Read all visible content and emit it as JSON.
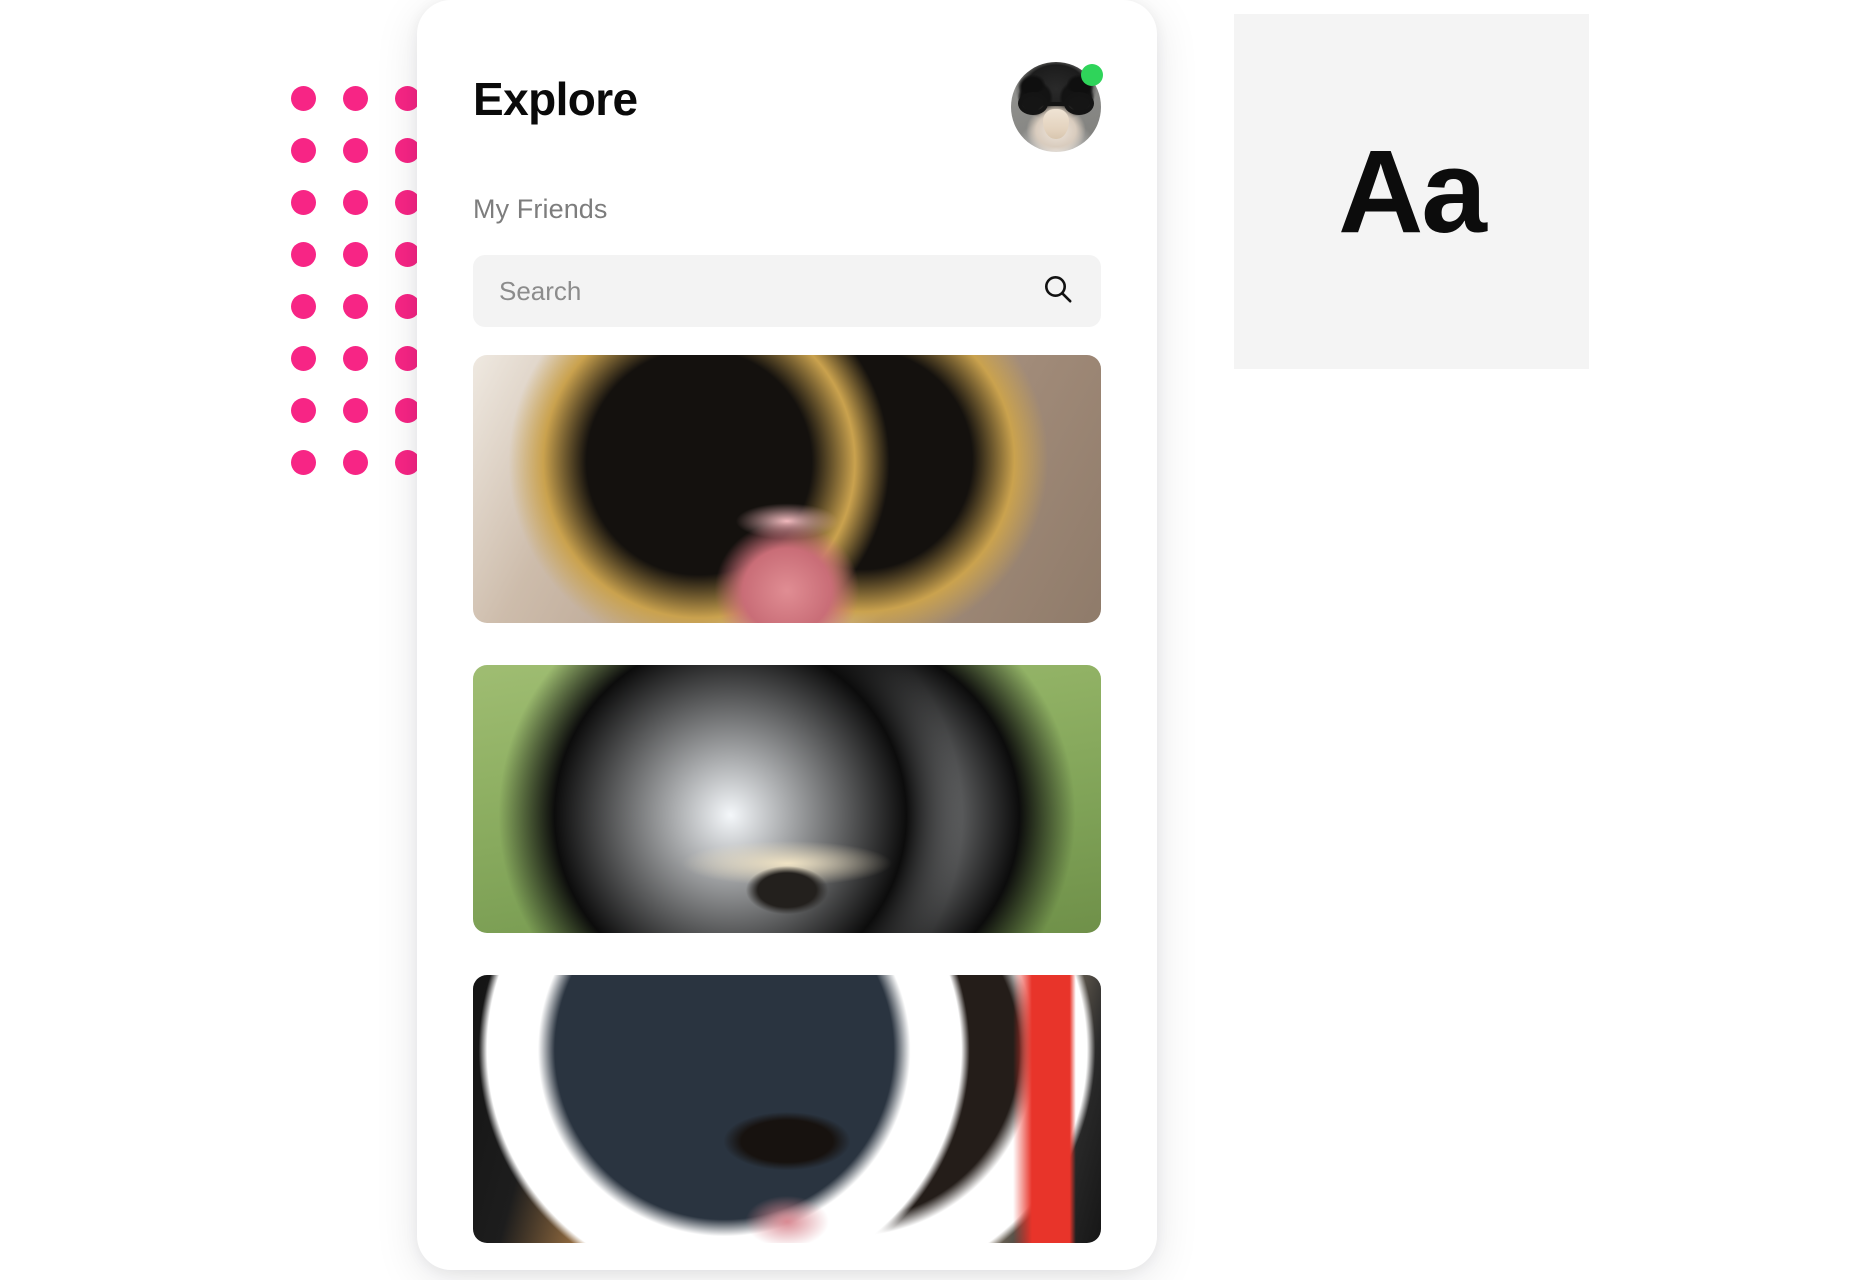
{
  "decor": {
    "dot_grid": {
      "name": "pink-dot-grid",
      "color": "#F72585",
      "columns": 3,
      "rows": 8
    }
  },
  "app": {
    "header": {
      "title": "Explore",
      "avatar": {
        "icon": "dog-avatar-with-glasses",
        "status": "online",
        "status_color": "#2FD45A"
      }
    },
    "subtitle": "My Friends",
    "search": {
      "placeholder": "Search",
      "value": "",
      "icon": "search-icon",
      "background": "#f3f3f3"
    },
    "feed": [
      {
        "id": "card-cat",
        "subject": "cat-photo",
        "alt": "Tabby cat with open mouth"
      },
      {
        "id": "card-raccoon",
        "subject": "raccoon-photo",
        "alt": "Raccoon on green grass"
      },
      {
        "id": "card-dog",
        "subject": "dog-photo",
        "alt": "Chow chow dog wearing white sunglasses"
      }
    ]
  },
  "typography": {
    "sample": "Aa",
    "swatch_background": "#f4f4f4",
    "text_color": "#0c0c0c"
  }
}
